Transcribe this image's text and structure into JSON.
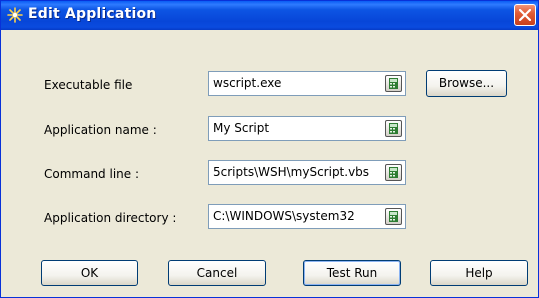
{
  "window": {
    "title": "Edit Application",
    "icon": "sparkle-app-icon",
    "close_icon": "close-icon"
  },
  "fields": [
    {
      "label": "Executable file",
      "value": "wscript.exe"
    },
    {
      "label": "Application name :",
      "value": "My Script"
    },
    {
      "label": "Command line :",
      "value": "5cripts\\WSH\\myScript.vbs"
    },
    {
      "label": "Application directory :",
      "value": "C:\\WINDOWS\\system32"
    }
  ],
  "buttons": {
    "browse": "Browse...",
    "ok": "OK",
    "cancel": "Cancel",
    "test_run": "Test Run",
    "help": "Help"
  },
  "colors": {
    "titlebar": "#0A4BDF",
    "dialog_bg": "#ECE9D8",
    "close": "#E15C36"
  }
}
